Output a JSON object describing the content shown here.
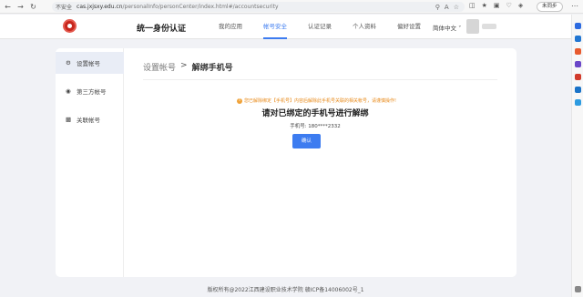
{
  "browser": {
    "insecure_label": "不安全",
    "url_host": "cas.jxjsxy.edu.cn",
    "url_path": "/personalInfo/personCenter/index.html#/accountsecurity",
    "update_label": "未同步"
  },
  "header": {
    "site_title": "统一身份认证",
    "nav": [
      "我的应用",
      "帐号安全",
      "认证记录",
      "个人资料",
      "偏好设置"
    ],
    "active_index": 1,
    "language": "简体中文"
  },
  "sidebar": {
    "items": [
      {
        "label": "设置帐号",
        "icon": "gear-icon"
      },
      {
        "label": "第三方帐号",
        "icon": "chat-icon"
      },
      {
        "label": "关联帐号",
        "icon": "link-icon"
      }
    ]
  },
  "main": {
    "breadcrumb_parent": "设置帐号",
    "breadcrumb_sep": ">",
    "breadcrumb_current": "解绑手机号",
    "notice": "您已解除绑定【手机号】内容后解除此手机号关联的相关帐号，请谨慎操作!",
    "heading": "请对已绑定的手机号进行解绑",
    "phone_label": "手机号:",
    "phone_value": "180****2332",
    "confirm_label": "确认"
  },
  "footer": {
    "text": "版权所有@2022江西建设职业技术学院 赣ICP备14006002号_1"
  },
  "colors": {
    "accent": "#3d7cf0",
    "warning": "#e88a1a",
    "logo": "#c7261d"
  }
}
